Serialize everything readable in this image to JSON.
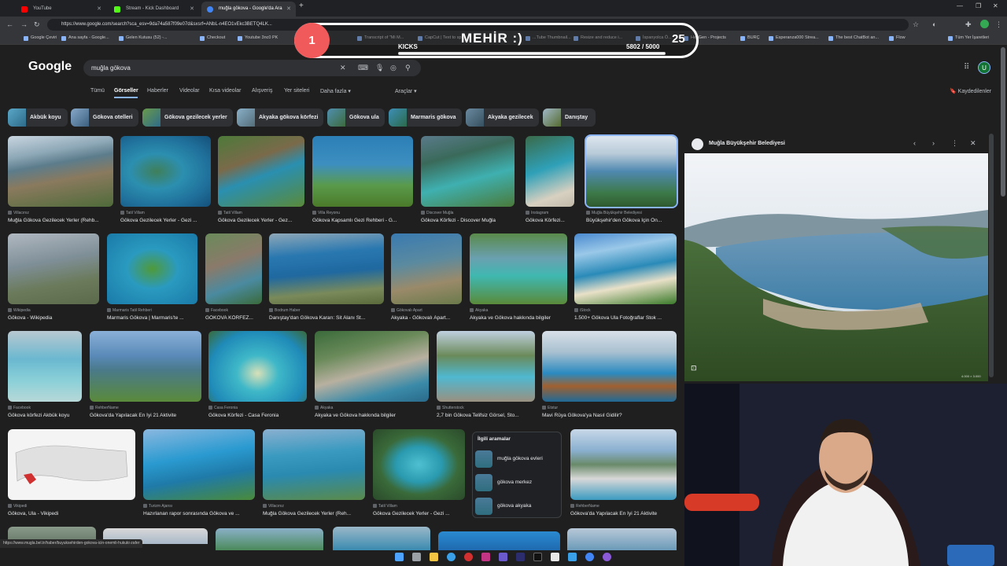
{
  "browser": {
    "tabs": [
      {
        "title": "YouTube",
        "favicon_color": "#ff0000"
      },
      {
        "title": "Stream - Kick Dashboard",
        "favicon_color": "#53fc18"
      },
      {
        "title": "muğla gökova - Google'da Ara",
        "favicon_color": "#4285f4"
      }
    ],
    "url": "https://www.google.com/search?sca_esv=9da74a587f09e07d&sxsrf=ANbL-n4EO1vEkc3BETQ4LK...",
    "bookmarks": [
      "Google Çeviri",
      "Ana sayfa - Google...",
      "Gelen Kutusu (52) -...",
      "Checkout",
      "Youtube 3nc0 PK",
      "Transcript of \"Mi M...",
      "CapCut | Text to sp...",
      "...Tube Thumbnail...",
      "Resize and reduce i...",
      "İspanyolca Ö...",
      "HeyGen - Projects",
      "BURÇ",
      "Esperanza000 Strea...",
      "The best ChatBot an...",
      "Flow",
      "Tüm Yer İşaretleri"
    ]
  },
  "overlay": {
    "badge": "1",
    "name": "MEHİR :)",
    "count": "25",
    "kicks_label": "KICKS",
    "progress_text": "5802  / 5000",
    "progress_fraction": 1.0
  },
  "google": {
    "logo": "Google",
    "query": "muğla gökova",
    "tabs": [
      "Tümü",
      "Görseller",
      "Haberler",
      "Videolar",
      "Kısa videolar",
      "Alışveriş",
      "Yer siteleri",
      "Daha fazla ▾"
    ],
    "tools": "Araçlar ▾",
    "saved": "Kaydedilenler",
    "avatar_letter": "U",
    "chips": [
      "Akbük koyu",
      "Gökova otelleri",
      "Gökova gezilecek yerler",
      "Akyaka gökova körfezi",
      "Gökova ula",
      "Marmaris gökova",
      "Akyaka gezilecek",
      "Danıştay"
    ]
  },
  "results": [
    {
      "source": "Villacınız",
      "title": "Muğla Gökova Gezilecek Yerler (Rehb..."
    },
    {
      "source": "Tatil Villam",
      "title": "Gökova Gezilecek Yerler - Gezi ..."
    },
    {
      "source": "Tatil Villam",
      "title": "Gökova Gezilecek Yerler - Gez..."
    },
    {
      "source": "Villa Reyonu",
      "title": "Gökova Kapsamlı Gezi Rehberi - G..."
    },
    {
      "source": "Discover Muğla",
      "title": "Gökova Körfezi - Discover Muğla"
    },
    {
      "source": "Instagram",
      "title": "Gökova Körfezi..."
    },
    {
      "source": "Muğla Büyükşehir Belediyesi",
      "title": "Büyükşehir'den Gökova İçin Ön..."
    },
    {
      "source": "Wikipedia",
      "title": "Gökova - Wikipedia"
    },
    {
      "source": "Marmaris Tatil Rehberi",
      "title": "Marmaris Gökova | Marmaris'te ..."
    },
    {
      "source": "Facebook",
      "title": "GÖKOVA KÖRFEZ..."
    },
    {
      "source": "Bodrum Haber",
      "title": "Danıştay'dan Gökova Kararı: Sit Alanı St..."
    },
    {
      "source": "Gökovalı Apart",
      "title": "Akyaka - Gökovalı Apart..."
    },
    {
      "source": "Akyaka",
      "title": "Akyaka ve Gökova hakkında bilgiler"
    },
    {
      "source": "iStock",
      "title": "1.500+ Gökova Ula Fotoğraflar Stok ..."
    },
    {
      "source": "Facebook",
      "title": "Gökova körfezi Akbük koyu"
    },
    {
      "source": "RehberName",
      "title": "Gökova'da Yapılacak En İyi 21 Aktivite"
    },
    {
      "source": "Casa Feronia",
      "title": "Gökova Körfezi - Casa Feronia"
    },
    {
      "source": "Akyaka",
      "title": "Akyaka ve Gökova hakkında bilgiler"
    },
    {
      "source": "Shutterstock",
      "title": "2,7 bin Gökova Telifsiz Görsel, Sto..."
    },
    {
      "source": "Etstur",
      "title": "Mavi Rüya Gökova'ya Nasıl Gidilir?"
    },
    {
      "source": "Vikipedi",
      "title": "Gökova, Ula - Vikipedi"
    },
    {
      "source": "Turizm Ajansı",
      "title": "Hazırlanan rapor sonrasında Gökova ve ..."
    },
    {
      "source": "Villacınız",
      "title": "Muğla Gökova Gezilecek Yerler (Reh..."
    },
    {
      "source": "Tatil Villam",
      "title": "Gökova Gezilecek Yerler - Gezi ..."
    },
    {
      "source": "RehberName",
      "title": "Gökova'da Yapılacak En İyi 21 Aktivite"
    }
  ],
  "related": {
    "title": "İlgili aramalar",
    "items": [
      "muğla gökova evleri",
      "gökova merkez",
      "gökova akyaka"
    ]
  },
  "preview": {
    "source": "Muğla Büyükşehir Belediyesi",
    "size": "4.000 × 3.000"
  },
  "status_url": "https://www.mugla.bel.tr/haber/buyuksehirden-gokova-icin-onemli-hukuki-zafer"
}
